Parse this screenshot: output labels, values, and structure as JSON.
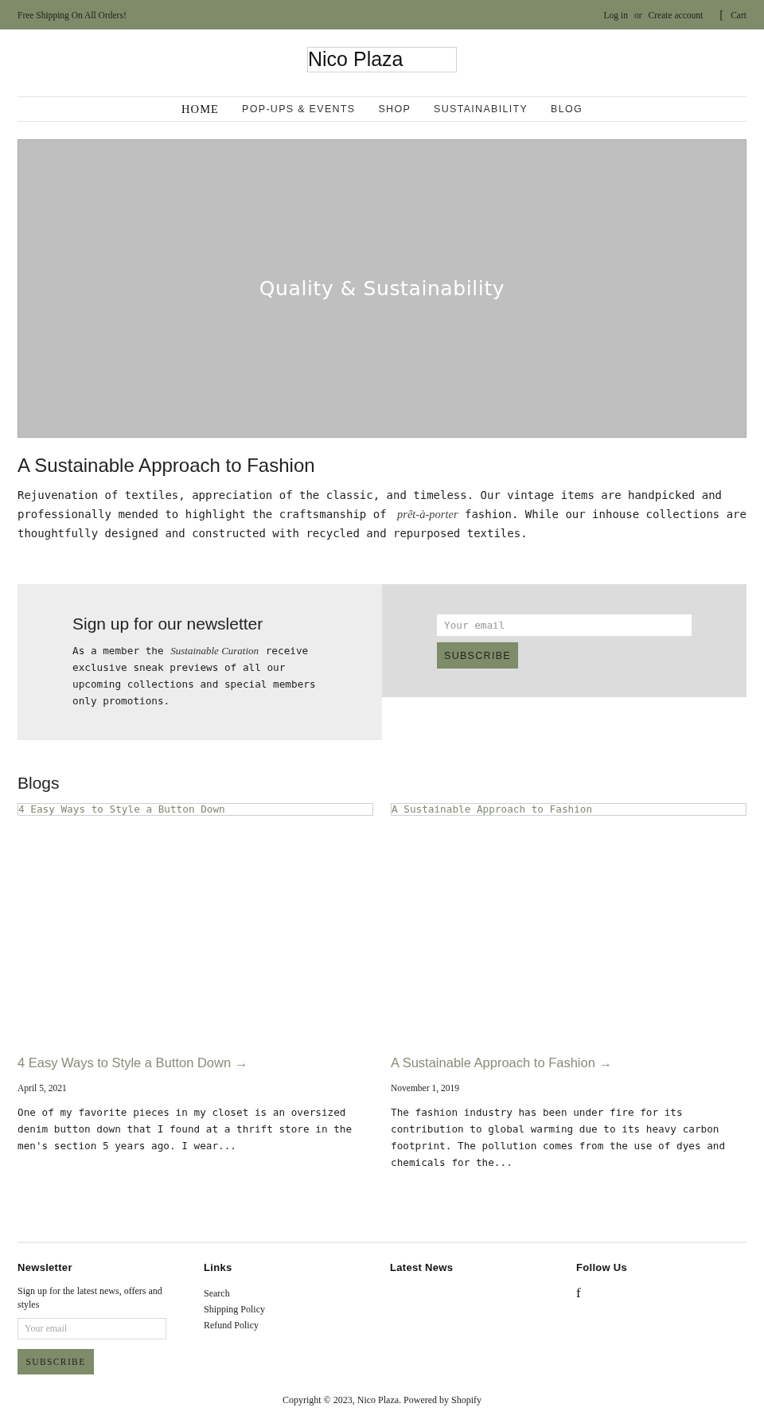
{
  "announcement": {
    "message": "Free Shipping On All Orders!",
    "login": "Log in",
    "separator": "or",
    "register": "Create account",
    "cart_glyph": "[",
    "cart": "Cart"
  },
  "logo": {
    "alt": "Nico Plaza"
  },
  "nav": [
    {
      "label": "HOME",
      "selected": true
    },
    {
      "label": "POP-UPS & EVENTS",
      "selected": false
    },
    {
      "label": "SHOP",
      "selected": false
    },
    {
      "label": "SUSTAINABILITY",
      "selected": false
    },
    {
      "label": "BLOG",
      "selected": false
    }
  ],
  "hero": {
    "caption": "Quality & Sustainability"
  },
  "intro": {
    "title": "A Sustainable Approach to Fashion",
    "body": "Rejuvenation of textiles, appreciation of the classic, and timeless. Our vintage items are handpicked and professionally mended to highlight the craftsmanship of *prêt-à-porter* fashion. While our inhouse collections are thoughtfully designed and constructed with recycled and repurposed textiles."
  },
  "newsletter": {
    "title": "Sign up for our newsletter",
    "body": "As a member the *Sustainable Curation* receive exclusive sneak previews of all our upcoming collections and special members only promotions.",
    "placeholder": "Your email",
    "button": "SUBSCRIBE"
  },
  "blogs": {
    "title": "Blogs",
    "posts": [
      {
        "image_alt": "4 Easy Ways to Style a Button Down",
        "title": "4 Easy Ways to Style a Button Down →",
        "date": "April 5, 2021",
        "excerpt": "One of my favorite pieces in my closet is an oversized denim button down that I found at a thrift store in the men's section 5 years ago. I wear..."
      },
      {
        "image_alt": "A Sustainable Approach to Fashion",
        "title": "A Sustainable Approach to Fashion →",
        "date": "November 1, 2019",
        "excerpt": "The fashion industry has been under fire for its contribution to global warming due to its heavy carbon footprint. The pollution comes from the use of dyes and chemicals for the..."
      }
    ]
  },
  "footer": {
    "columns": [
      {
        "kind": "newsletter",
        "heading": "Newsletter",
        "text": "Sign up for the latest news, offers and styles",
        "placeholder": "Your email",
        "button": "SUBSCRIBE"
      },
      {
        "kind": "links",
        "heading": "Links",
        "links": [
          "Search",
          "Shipping Policy",
          "Refund Policy"
        ]
      },
      {
        "kind": "plain",
        "heading": "Latest News"
      },
      {
        "kind": "social",
        "heading": "Follow Us",
        "icons": [
          "f"
        ]
      }
    ],
    "copyright": "Copyright © 2023, Nico Plaza. Powered by Shopify"
  }
}
